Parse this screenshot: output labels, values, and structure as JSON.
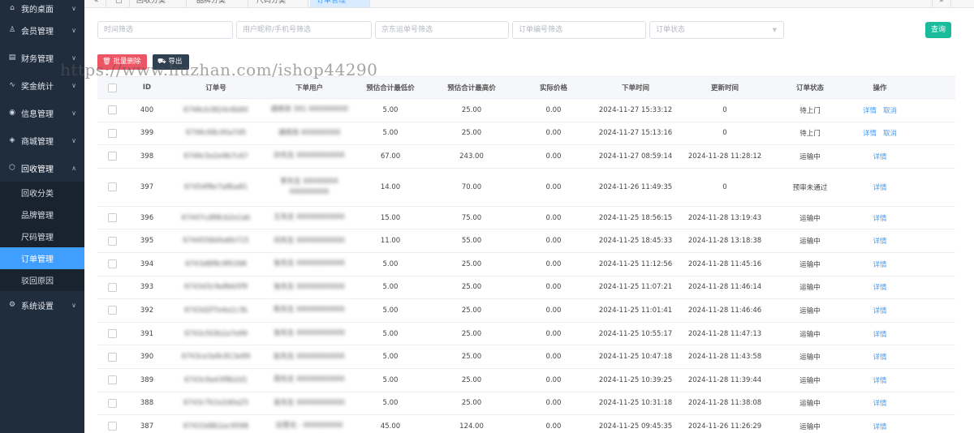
{
  "sidebar": {
    "items": [
      {
        "label": "我的桌面",
        "icon": "home-icon"
      },
      {
        "label": "会员管理",
        "icon": "user-icon"
      },
      {
        "label": "财务管理",
        "icon": "ledger-icon"
      },
      {
        "label": "奖金统计",
        "icon": "pulse-icon"
      },
      {
        "label": "信息管理",
        "icon": "eye-icon"
      },
      {
        "label": "商城管理",
        "icon": "box-icon"
      },
      {
        "label": "回收管理",
        "icon": "cube-icon"
      }
    ],
    "submenu": [
      "回收分类",
      "品牌管理",
      "尺码管理",
      "订单管理",
      "驳回原因"
    ],
    "active_submenu": "订单管理",
    "bottom_item": {
      "label": "系统设置",
      "icon": "settings-icon"
    }
  },
  "tabs": [
    "回收分类",
    "品牌分类",
    "尺码分类",
    "订单管理"
  ],
  "filters": {
    "time": "时间筛选",
    "user": "用户昵称/手机号筛选",
    "jd": "京东运单号筛选",
    "order_no": "订单编号筛选",
    "status": "订单状态",
    "query": "查询"
  },
  "actions": {
    "batch_delete": "批量删除",
    "export": "导出"
  },
  "watermark": "https://www.huzhan.com/ishop44290",
  "colors": {
    "sidebar": "#1f2d3d",
    "active": "#409eff",
    "query": "#1abc9c",
    "delete": "#ed5565",
    "export": "#2f4050"
  },
  "table": {
    "columns": [
      "ID",
      "订单号",
      "下单用户",
      "预估合计最低价",
      "预估合计最高价",
      "实际价格",
      "下单时间",
      "更新时间",
      "订单状态",
      "操作"
    ],
    "rows": [
      {
        "id": "400",
        "order": "6746cb3824c6b60",
        "user": "请修改 391 000000000",
        "user2": "",
        "low": "5.00",
        "high": "25.00",
        "actual": "0.00",
        "created": "2024-11-27 15:33:12",
        "updated": "0",
        "status": "待上门",
        "detail": "详情",
        "cancel": "取消"
      },
      {
        "id": "399",
        "order": "6746c68c40a7d0",
        "user": "请修改 000000000",
        "user2": "",
        "low": "5.00",
        "high": "25.00",
        "actual": "0.00",
        "created": "2024-11-27 15:13:16",
        "updated": "0",
        "status": "待上门",
        "detail": "详情",
        "cancel": "取消"
      },
      {
        "id": "398",
        "order": "6746c5e2e9b7c67",
        "user": "孙先生 00000000000",
        "user2": "",
        "low": "67.00",
        "high": "243.00",
        "actual": "0.00",
        "created": "2024-11-27 08:59:14",
        "updated": "2024-11-28 11:28:12",
        "status": "运输中",
        "detail": "详情",
        "cancel": ""
      },
      {
        "id": "397",
        "order": "67454f8e7a8ba81",
        "user": "李先生 00000000",
        "user2": "000000000",
        "low": "14.00",
        "high": "70.00",
        "actual": "0.00",
        "created": "2024-11-26 11:49:35",
        "updated": "0",
        "status": "预审未通过",
        "detail": "详情",
        "cancel": ""
      },
      {
        "id": "396",
        "order": "67447cd88cb2e1ab",
        "user": "王先生 00000000000",
        "user2": "",
        "low": "15.00",
        "high": "75.00",
        "actual": "0.00",
        "created": "2024-11-25 18:56:15",
        "updated": "2024-11-28 13:19:43",
        "status": "运输中",
        "detail": "详情",
        "cancel": ""
      },
      {
        "id": "395",
        "order": "6744558d4a6b715",
        "user": "刘先生 00000000000",
        "user2": "",
        "low": "11.00",
        "high": "55.00",
        "actual": "0.00",
        "created": "2024-11-25 18:45:33",
        "updated": "2024-11-28 13:18:38",
        "status": "运输中",
        "detail": "详情",
        "cancel": ""
      },
      {
        "id": "394",
        "order": "6743d8f8c9f0398",
        "user": "张先生 00000000000",
        "user2": "",
        "low": "5.00",
        "high": "25.00",
        "actual": "0.00",
        "created": "2024-11-25 11:12:56",
        "updated": "2024-11-28 11:45:16",
        "status": "运输中",
        "detail": "详情",
        "cancel": ""
      },
      {
        "id": "393",
        "order": "6743d3c9a8bb5f9",
        "user": "张先生 00000000000",
        "user2": "",
        "low": "5.00",
        "high": "25.00",
        "actual": "0.00",
        "created": "2024-11-25 11:07:21",
        "updated": "2024-11-28 11:46:14",
        "status": "运输中",
        "detail": "详情",
        "cancel": ""
      },
      {
        "id": "392",
        "order": "6743d2f7e4a1c3b",
        "user": "陈先生 00000000000",
        "user2": "",
        "low": "5.00",
        "high": "25.00",
        "actual": "0.00",
        "created": "2024-11-25 11:01:41",
        "updated": "2024-11-28 11:46:46",
        "status": "运输中",
        "detail": "详情",
        "cancel": ""
      },
      {
        "id": "391",
        "order": "6743cfd3b2a7e99",
        "user": "张先生 00000000000",
        "user2": "",
        "low": "5.00",
        "high": "25.00",
        "actual": "0.00",
        "created": "2024-11-25 10:55:17",
        "updated": "2024-11-28 11:47:13",
        "status": "运输中",
        "detail": "详情",
        "cancel": ""
      },
      {
        "id": "390",
        "order": "6743ce3a9c813e99",
        "user": "赵先生 00000000000",
        "user2": "",
        "low": "5.00",
        "high": "25.00",
        "actual": "0.00",
        "created": "2024-11-25 10:47:18",
        "updated": "2024-11-28 11:43:58",
        "status": "运输中",
        "detail": "详情",
        "cancel": ""
      },
      {
        "id": "389",
        "order": "6743c9a43f8b2d1",
        "user": "周先生 00000000000",
        "user2": "",
        "low": "5.00",
        "high": "25.00",
        "actual": "0.00",
        "created": "2024-11-25 10:39:25",
        "updated": "2024-11-28 11:39:44",
        "status": "运输中",
        "detail": "详情",
        "cancel": ""
      },
      {
        "id": "388",
        "order": "6743c7b1e2d0a25",
        "user": "吴先生 00000000000",
        "user2": "",
        "low": "5.00",
        "high": "25.00",
        "actual": "0.00",
        "created": "2024-11-25 10:31:18",
        "updated": "2024-11-28 11:38:08",
        "status": "运输中",
        "detail": "详情",
        "cancel": ""
      },
      {
        "id": "387",
        "order": "67433d8b1ec9598",
        "user": "边雪光 - 000000000",
        "user2": "",
        "low": "45.00",
        "high": "124.00",
        "actual": "0.00",
        "created": "2024-11-25 09:45:35",
        "updated": "2024-11-26 11:26:29",
        "status": "运输中",
        "detail": "详情",
        "cancel": ""
      }
    ]
  }
}
